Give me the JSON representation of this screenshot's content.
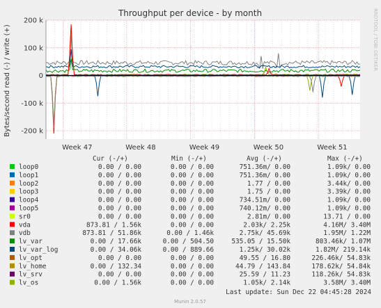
{
  "chart_data": {
    "type": "line",
    "title": "Throughput per device - by month",
    "ylabel": "Bytes/second read (-) / write (+)",
    "ylim": [
      -230000,
      200000
    ],
    "y_ticks": [
      {
        "value": 200000,
        "label": "200 k"
      },
      {
        "value": 100000,
        "label": "100 k"
      },
      {
        "value": 0,
        "label": "0"
      },
      {
        "value": -100000,
        "label": "-100 k"
      },
      {
        "value": -200000,
        "label": "-200 k"
      }
    ],
    "x_ticks": [
      {
        "pos": 0.055,
        "label": "Week 47"
      },
      {
        "pos": 0.257,
        "label": "Week 48"
      },
      {
        "pos": 0.46,
        "label": "Week 49"
      },
      {
        "pos": 0.664,
        "label": "Week 50"
      },
      {
        "pos": 0.867,
        "label": "Week 51"
      }
    ],
    "grid": true,
    "series": [
      {
        "name": "loop0",
        "color": "#00cc00",
        "cur": "0.00 /   0.00",
        "min": "0.00 /   0.00",
        "avg": "751.36m/   0.00",
        "max": "1.09k/   0.00"
      },
      {
        "name": "loop1",
        "color": "#0066b3",
        "cur": "0.00 /   0.00",
        "min": "0.00 /   0.00",
        "avg": "751.36m/   0.00",
        "max": "1.09k/   0.00"
      },
      {
        "name": "loop2",
        "color": "#ff8000",
        "cur": "0.00 /   0.00",
        "min": "0.00 /   0.00",
        "avg": "1.77 /   0.00",
        "max": "3.44k/   0.00"
      },
      {
        "name": "loop3",
        "color": "#ffcc00",
        "cur": "0.00 /   0.00",
        "min": "0.00 /   0.00",
        "avg": "1.75 /   0.00",
        "max": "3.39k/   0.00"
      },
      {
        "name": "loop4",
        "color": "#330099",
        "cur": "0.00 /   0.00",
        "min": "0.00 /   0.00",
        "avg": "734.51m/   0.00",
        "max": "1.09k/   0.00"
      },
      {
        "name": "loop5",
        "color": "#990099",
        "cur": "0.00 /   0.00",
        "min": "0.00 /   0.00",
        "avg": "740.12m/   0.00",
        "max": "1.09k/   0.00"
      },
      {
        "name": "sr0",
        "color": "#ccff00",
        "cur": "0.00 /   0.00",
        "min": "0.00 /   0.00",
        "avg": "2.81m/   0.00",
        "max": "13.71 /   0.00"
      },
      {
        "name": "vda",
        "color": "#ff0000",
        "cur": "873.81 /   1.56k",
        "min": "0.00 /   0.00",
        "avg": "2.03k/   2.25k",
        "max": "4.16M/   3.40M"
      },
      {
        "name": "vdb",
        "color": "#808080",
        "cur": "873.81 /  51.86k",
        "min": "0.00 /   1.46k",
        "avg": "2.75k/  45.69k",
        "max": "1.95M/   1.22M"
      },
      {
        "name": "lv_var",
        "color": "#008f00",
        "cur": "0.00 /  17.66k",
        "min": "0.00 / 504.50",
        "avg": "535.05 /  15.50k",
        "max": "803.46k/   1.07M"
      },
      {
        "name": "lv_var_log",
        "color": "#00487d",
        "cur": "0.00 /  34.06k",
        "min": "0.00 / 889.66",
        "avg": "1.25k/  30.02k",
        "max": "1.82M/ 219.14k"
      },
      {
        "name": "lv_opt",
        "color": "#b35a00",
        "cur": "0.00 /   0.00",
        "min": "0.00 /   0.00",
        "avg": "49.55 /  16.80",
        "max": "226.46k/  54.83k"
      },
      {
        "name": "lv_home",
        "color": "#b38f00",
        "cur": "0.00 / 132.34",
        "min": "0.00 /   0.00",
        "avg": "44.79 / 143.84",
        "max": "178.62k/  54.84k"
      },
      {
        "name": "lv_srv",
        "color": "#6b006b",
        "cur": "0.00 /   0.00",
        "min": "0.00 /   0.00",
        "avg": "25.59 /  11.23",
        "max": "118.26k/  54.83k"
      },
      {
        "name": "lv_os",
        "color": "#8fb300",
        "cur": "0.00 /   1.56k",
        "min": "0.00 /   0.00",
        "avg": "1.05k/   2.14k",
        "max": "3.58M/   3.40M"
      }
    ]
  },
  "legend_headers": {
    "cur": "Cur (-/+)",
    "min": "Min (-/+)",
    "avg": "Avg (-/+)",
    "max": "Max (-/+)"
  },
  "side_label": "RRDTOOL / TOBI OETIKER",
  "last_update": "Last update: Sun Dec 22 04:45:28 2024",
  "footer": "Munin 2.0.57"
}
